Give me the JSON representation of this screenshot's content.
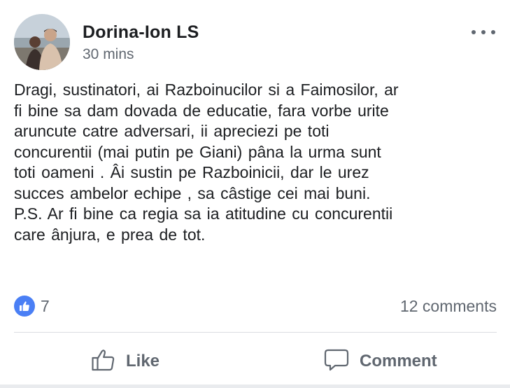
{
  "post": {
    "author": "Dorina-Ion LS",
    "timestamp": "30 mins",
    "more_icon": "ellipsis-icon",
    "text": "Dragi,  sustinatori,  ai Razboinucilor  si  a Faimosilor, ar\nfi  bine  sa dam dovada  de educatie,  fara  vorbe  urite\naruncute  catre  adversari,  ii apreciezi  pe toti\nconcurentii (mai  putin  pe  Giani)  pâna  la urma  sunt\ntoti  oameni . Âi sustin pe Razboinicii,  dar  le urez\nsucces  ambelor  echipe ,  sa câstige  cei  mai  buni.\nP.S.  Ar fi  bine  ca regia  sa ia atitudine  cu concurentii\ncare ânjura, e prea  de tot."
  },
  "stats": {
    "like_icon": "thumbs-up-icon",
    "likes": "7",
    "comments": "12 comments"
  },
  "actions": {
    "like_label": "Like",
    "like_icon": "thumbs-up-outline-icon",
    "comment_label": "Comment",
    "comment_icon": "speech-bubble-icon"
  },
  "colors": {
    "like_badge": "#4a7ff5",
    "secondary_text": "#606770",
    "primary_text": "#1c1e21",
    "divider": "#dadde1"
  }
}
